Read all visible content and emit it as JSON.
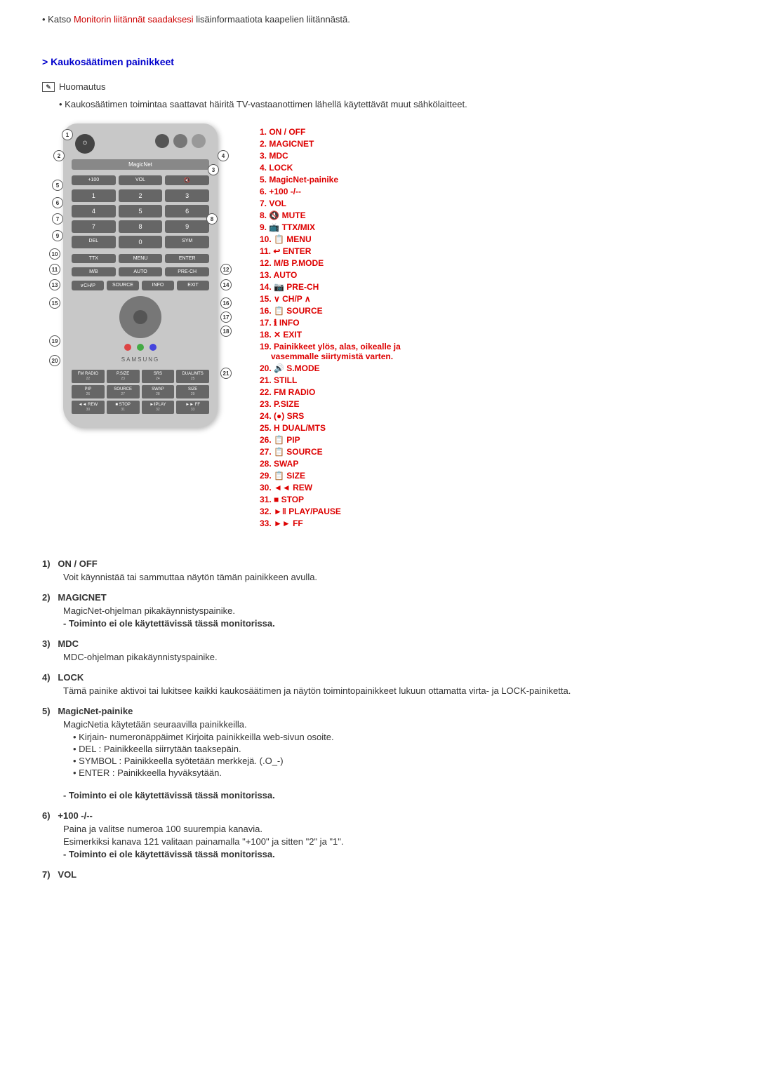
{
  "top_note": {
    "prefix": "• Katso ",
    "link_text": "Monitorin liitännät saadaksesi",
    "suffix": " lisäinformaatiota kaapelien liitännästä."
  },
  "section_heading": "Kaukosäätimen painikkeet",
  "note_label": "Huomautus",
  "warning_text": "Kaukosäätimen toimintaa saattavat häiritä TV-vastaanottimen lähellä käytettävät muut sähkölaitteet.",
  "legend_items": [
    "1. ON / OFF",
    "2. MAGICNET",
    "3. MDC",
    "4. LOCK",
    "5. MagicNet-painike",
    "6. +100 -/--",
    "7. VOL",
    "8. 🔇 MUTE",
    "9. 📺 TTX/MIX",
    "10. 📋 MENU",
    "11. ↩ ENTER",
    "12. M/B P.MODE",
    "13. AUTO",
    "14. 📷 PRE-CH",
    "15. ∨ CH/P ∧",
    "16. 📋 SOURCE",
    "17. ℹ INFO",
    "18. ✕ EXIT",
    "19. Painikkeet ylös, alas, oikealle ja vasemmalle siirtymistä varten.",
    "20. 🔊 S.MODE",
    "21. STILL",
    "22. FM RADIO",
    "23. P.SIZE",
    "24. (●) SRS",
    "25. H DUAL/MTS",
    "26. 📋 PIP",
    "27. 📋 SOURCE",
    "28. SWAP",
    "29. 📋 SIZE",
    "30. ◄◄ REW",
    "31. ■ STOP",
    "32. ►‖ PLAY/PAUSE",
    "33. ►► FF"
  ],
  "descriptions": [
    {
      "num": "1)",
      "title": "ON / OFF",
      "texts": [
        "Voit käynnistää tai sammuttaa näytön tämän painikkeen avulla."
      ],
      "bold": null,
      "bullets": []
    },
    {
      "num": "2)",
      "title": "MAGICNET",
      "texts": [
        "MagicNet-ohjelman pikakäynnistyspainike."
      ],
      "bold": "- Toiminto ei ole käytettävissä tässä monitorissa.",
      "bullets": []
    },
    {
      "num": "3)",
      "title": "MDC",
      "texts": [
        "MDC-ohjelman pikakäynnistyspainike."
      ],
      "bold": null,
      "bullets": []
    },
    {
      "num": "4)",
      "title": "LOCK",
      "texts": [
        "Tämä painike aktivoi tai lukitsee kaikki kaukosäätimen ja näytön toimintopainikkeet lukuun ottamatta virta- ja LOCK-painiketta."
      ],
      "bold": null,
      "bullets": []
    },
    {
      "num": "5)",
      "title": "MagicNet-painike",
      "texts": [
        "MagicNetia käytetään seuraavilla painikkeilla."
      ],
      "bold": "- Toiminto ei ole käytettävissä tässä monitorissa.",
      "bullets": [
        "Kirjain- numeronäppäimet Kirjoita painikkeilla web-sivun osoite.",
        "DEL : Painikkeella siirrytään taaksepäin.",
        "SYMBOL : Painikkeella syötetään merkkejä. (.O_-)",
        "ENTER : Painikkeella hyväksytään."
      ]
    },
    {
      "num": "6)",
      "title": "+100 -/--",
      "texts": [
        "Paina ja valitse numeroa 100 suurempia kanavia.",
        "Esimerkiksi kanava 121 valitaan painamalla \"+100\" ja sitten \"2\" ja \"1\"."
      ],
      "bold": "- Toiminto ei ole käytettävissä tässä monitorissa.",
      "bullets": []
    },
    {
      "num": "7)",
      "title": "VOL",
      "texts": [],
      "bold": null,
      "bullets": []
    }
  ]
}
